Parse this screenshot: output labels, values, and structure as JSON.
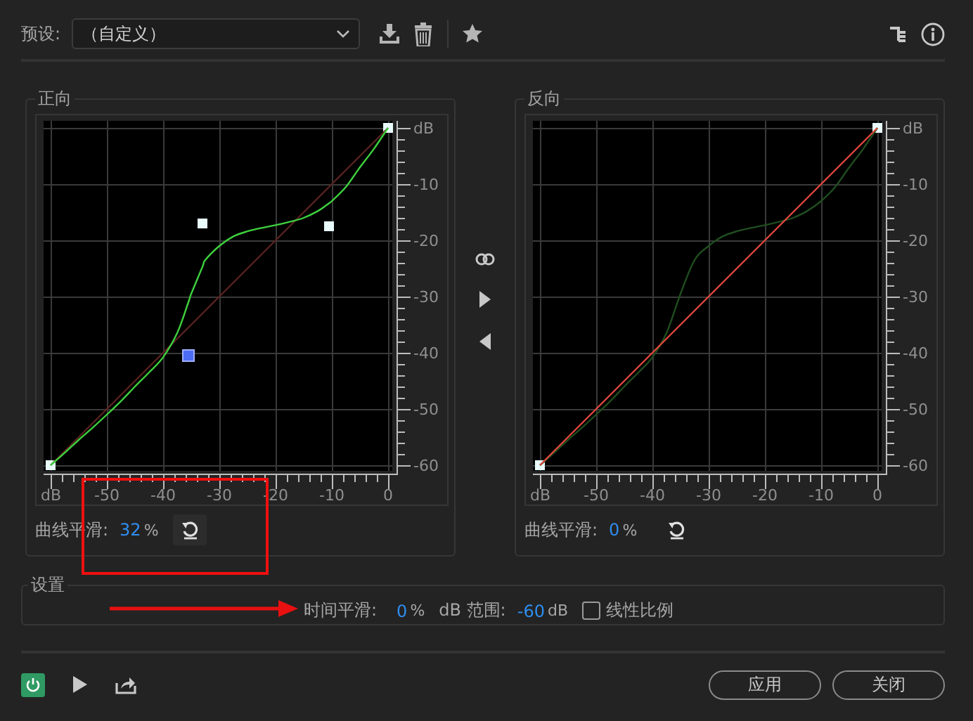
{
  "preset": {
    "label": "预设:",
    "value": "（自定义）"
  },
  "panels": [
    {
      "title": "正向",
      "chart_data": {
        "type": "line",
        "x": [
          -60,
          -57.5,
          -55,
          -52.5,
          -50,
          -47.5,
          -45,
          -42.5,
          -40,
          -37.5,
          -35.5,
          -35,
          -33,
          -32.5,
          -30,
          -27.5,
          -25,
          -22.5,
          -20,
          -17.5,
          -15,
          -12.5,
          -10.5,
          -10,
          -7.5,
          -5,
          -2.5,
          0
        ],
        "xlim": [
          -60,
          0
        ],
        "ylim": [
          -60,
          0
        ],
        "xticks": [
          {
            "value": -60,
            "label": "dB"
          },
          -50,
          -40,
          -30,
          -20,
          -10,
          0
        ],
        "yticks": [
          {
            "value": 0,
            "label": "dB"
          },
          -10,
          -20,
          -30,
          -40,
          -50,
          -60
        ],
        "grid": true,
        "series": [
          {
            "color": "#5a2222",
            "values": [
              -60,
              -57.5,
              -55,
              -52.5,
              -50,
              -47.5,
              -45,
              -42.5,
              -40,
              -37.5,
              -35.5,
              -35,
              -33,
              -32.5,
              -30,
              -27.5,
              -25,
              -22.5,
              -20,
              -17.5,
              -15,
              -12.5,
              -10.5,
              -10,
              -7.5,
              -5,
              -2.5,
              0
            ]
          },
          {
            "color": "#3fd03f",
            "values": [
              -60,
              -57.8,
              -55.5,
              -53.3,
              -51,
              -48.6,
              -46,
              -43.5,
              -40.8,
              -36.5,
              -31,
              -29.5,
              -24.7,
              -23.5,
              -21,
              -19.3,
              -18.4,
              -17.8,
              -17.3,
              -16.7,
              -16,
              -14.8,
              -13.4,
              -13,
              -10.5,
              -7,
              -3.7,
              0
            ]
          }
        ]
      },
      "control_points": [
        {
          "selected": false
        },
        {
          "selected": true
        },
        {
          "selected": false
        },
        {
          "selected": false
        },
        {
          "selected": false
        }
      ],
      "smoothing": {
        "label": "曲线平滑:",
        "value": "32",
        "unit": "%"
      }
    },
    {
      "title": "反向",
      "chart_data": {
        "type": "line",
        "x": [
          -60,
          -57.5,
          -55,
          -52.5,
          -50,
          -47.5,
          -45,
          -42.5,
          -40,
          -37.5,
          -35,
          -32.5,
          -30,
          -27.5,
          -25,
          -22.5,
          -20,
          -17.5,
          -15,
          -12.5,
          -10,
          -7.5,
          -5,
          -2.5,
          0
        ],
        "xlim": [
          -60,
          0
        ],
        "ylim": [
          -60,
          0
        ],
        "xticks": [
          {
            "value": -60,
            "label": "dB"
          },
          -50,
          -40,
          -30,
          -20,
          -10,
          0
        ],
        "yticks": [
          {
            "value": 0,
            "label": "dB"
          },
          -10,
          -20,
          -30,
          -40,
          -50,
          -60
        ],
        "grid": true,
        "series": [
          {
            "color": "#1f4d1f",
            "values": [
              -60,
              -57.8,
              -55.5,
              -53.3,
              -51,
              -48.6,
              -46,
              -43.5,
              -40.8,
              -36.5,
              -29.5,
              -23.5,
              -21,
              -19.3,
              -18.4,
              -17.8,
              -17.3,
              -16.7,
              -16,
              -14.8,
              -13,
              -10.5,
              -7,
              -3.7,
              0
            ]
          },
          {
            "color": "#e0483a",
            "values": [
              -60,
              -57.5,
              -55,
              -52.5,
              -50,
              -47.5,
              -45,
              -42.5,
              -40,
              -37.5,
              -35,
              -32.5,
              -30,
              -27.5,
              -25,
              -22.5,
              -20,
              -17.5,
              -15,
              -12.5,
              -10,
              -7.5,
              -5,
              -2.5,
              0
            ]
          }
        ]
      },
      "control_points": [
        {
          "selected": false
        },
        {
          "selected": false
        }
      ],
      "smoothing": {
        "label": "曲线平滑:",
        "value": "0",
        "unit": "%"
      }
    }
  ],
  "settings": {
    "title": "设置",
    "time_smoothing": {
      "label": "时间平滑:",
      "value": "0",
      "unit": "%"
    },
    "db_range": {
      "label": "dB 范围:",
      "value": "-60",
      "unit": "dB"
    },
    "linear_scale": {
      "label": "线性比例",
      "checked": false
    }
  },
  "power": {
    "on": true
  },
  "buttons": [
    "应用",
    "关闭"
  ],
  "annotations": [
    {
      "kind": "box"
    },
    {
      "kind": "arrow"
    }
  ]
}
